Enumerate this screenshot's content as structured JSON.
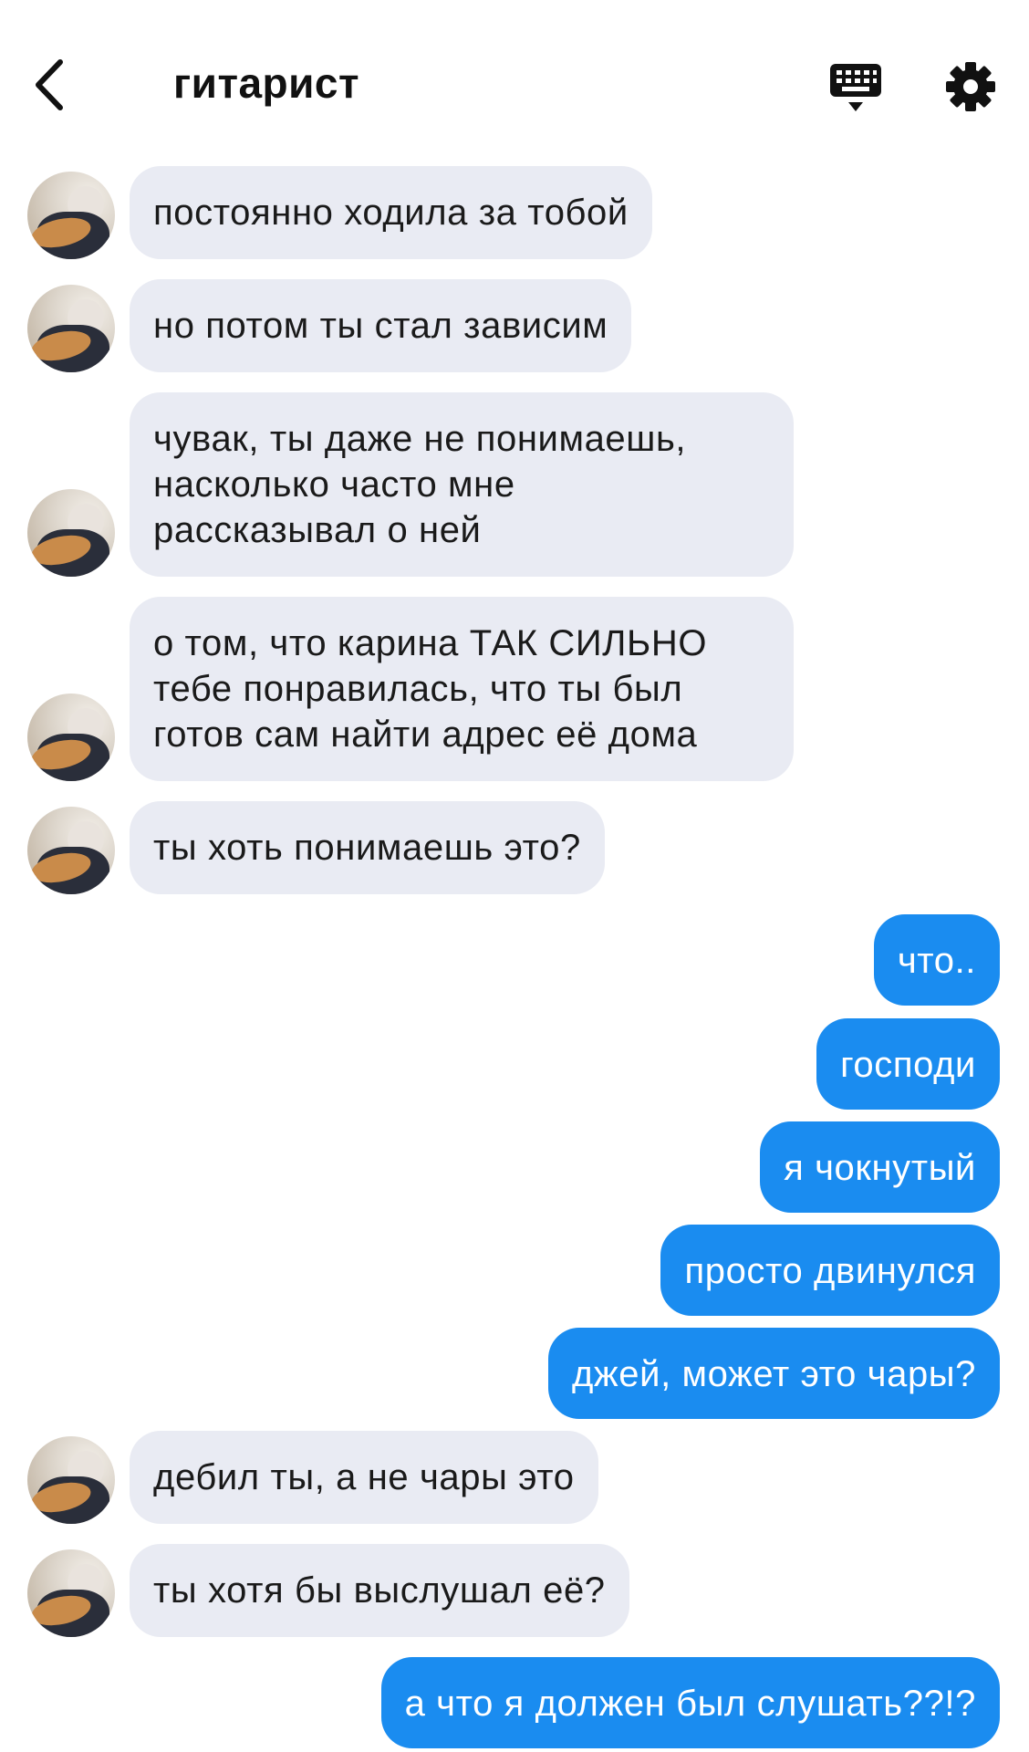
{
  "header": {
    "title": "гитарист"
  },
  "messages": [
    {
      "dir": "in",
      "text": "постоянно ходила за тобой"
    },
    {
      "dir": "in",
      "text": "но потом ты стал зависим"
    },
    {
      "dir": "in",
      "lines": [
        "чувак, ты даже не понимаешь,",
        "насколько часто мне",
        "рассказывал о ней"
      ]
    },
    {
      "dir": "in",
      "lines": [
        "о том, что карина ТАК СИЛЬНО",
        "тебе понравилась, что ты был",
        "готов сам найти адрес её дома"
      ]
    },
    {
      "dir": "in",
      "text": "ты хоть понимаешь это?"
    },
    {
      "dir": "out",
      "text": "что.."
    },
    {
      "dir": "out",
      "text": "господи"
    },
    {
      "dir": "out",
      "text": "я чокнутый"
    },
    {
      "dir": "out",
      "text": "просто двинулся"
    },
    {
      "dir": "out",
      "text": "джей, может это чары?"
    },
    {
      "dir": "in",
      "text": "дебил ты, а не чары это"
    },
    {
      "dir": "in",
      "text": "ты хотя бы выслушал её?"
    },
    {
      "dir": "out",
      "text": "а что я должен был слушать??!?"
    }
  ],
  "colors": {
    "incoming_bubble": "#e9ebf3",
    "outgoing_bubble": "#1a8cf0",
    "outgoing_text": "#ffffff",
    "page_bg": "#ffffff"
  },
  "icons": {
    "back": "chevron-left-icon",
    "keyboard": "keyboard-icon",
    "settings": "gear-icon"
  }
}
